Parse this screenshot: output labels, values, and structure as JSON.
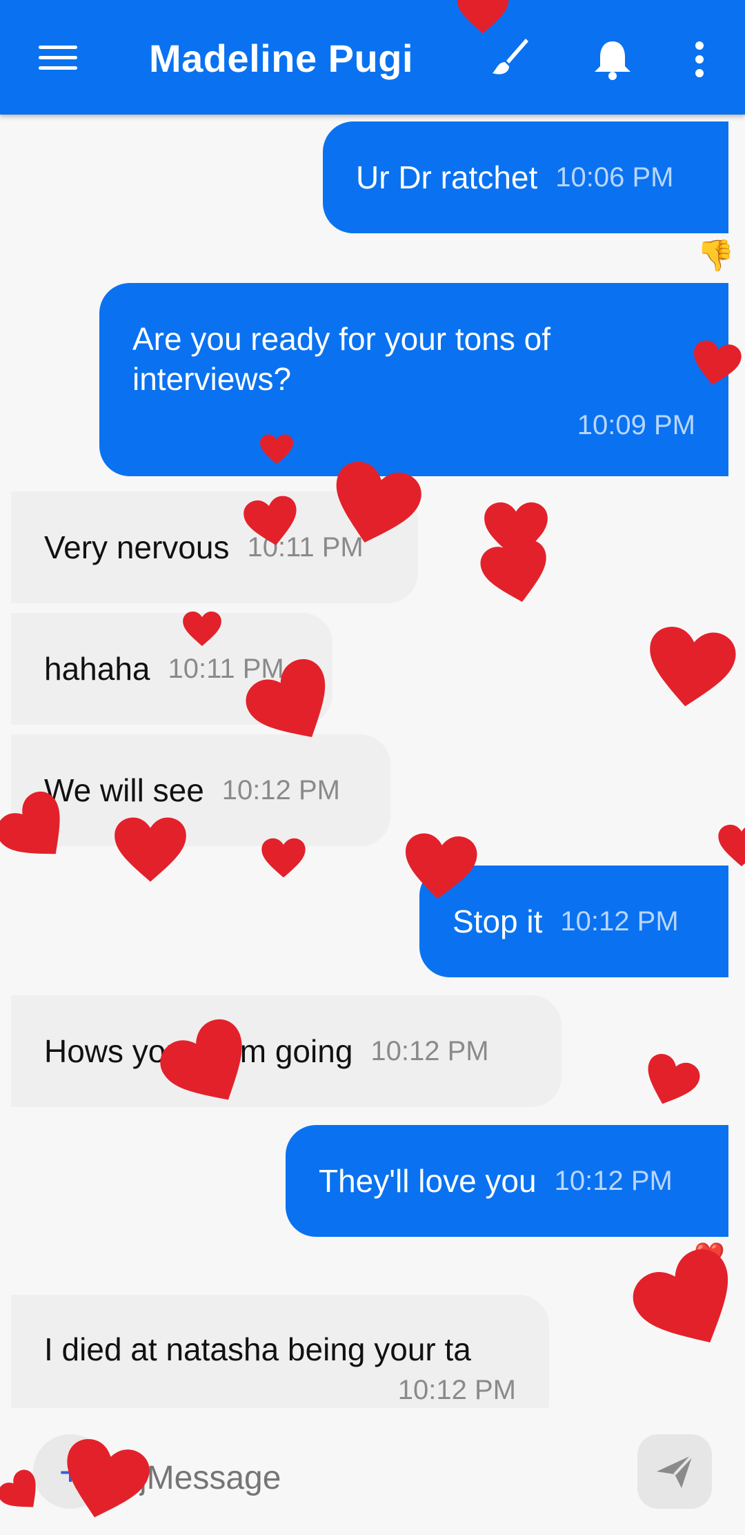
{
  "header": {
    "title": "Madeline Pugi",
    "icons": [
      "menu-icon",
      "brush-icon",
      "bell-icon",
      "more-vert-icon"
    ]
  },
  "messages": [
    {
      "direction": "out",
      "text": "Ur Dr ratchet",
      "time": "10:06 PM",
      "reaction": "👎"
    },
    {
      "direction": "out",
      "text": "Are you ready for your tons of interviews?",
      "time": "10:09 PM"
    },
    {
      "direction": "in",
      "text": "Very nervous",
      "time": "10:11 PM"
    },
    {
      "direction": "in",
      "text": "hahaha",
      "time": "10:11 PM"
    },
    {
      "direction": "in",
      "text": "We will see",
      "time": "10:12 PM"
    },
    {
      "direction": "out",
      "text": "Stop it",
      "time": "10:12 PM"
    },
    {
      "direction": "in",
      "text": "Hows your term going",
      "time": "10:12 PM"
    },
    {
      "direction": "out",
      "text": "They'll love you",
      "time": "10:12 PM",
      "reaction": "❤️"
    },
    {
      "direction": "in",
      "text": "I died at natasha being your ta",
      "time": "10:12 PM"
    }
  ],
  "composer": {
    "placeholder": "jMessage",
    "attach_label": "+"
  },
  "colors": {
    "header": "#0a72f0",
    "outgoing_bubble": "#0a72f0",
    "incoming_bubble": "#efefef",
    "heart": "#e3212b"
  }
}
